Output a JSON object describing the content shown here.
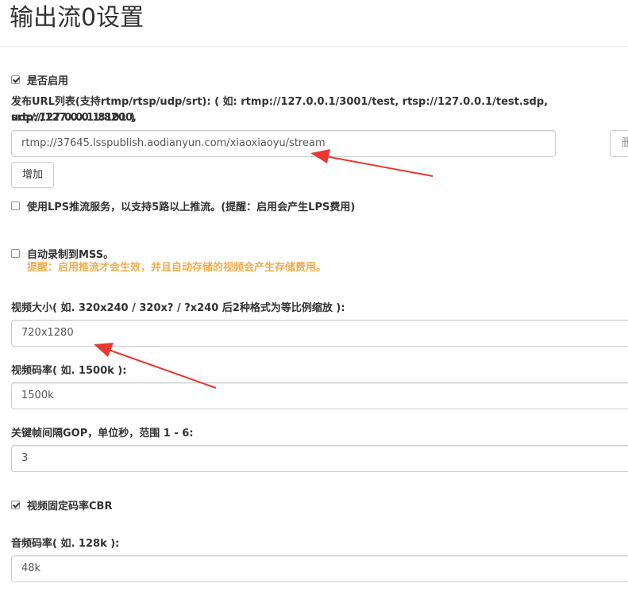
{
  "page": {
    "title": "输出流0设置"
  },
  "enable": {
    "label": "是否启用",
    "checked": true
  },
  "url_list": {
    "label_line1": "发布URL列表(支持rtmp/rtsp/udp/srt): ( 如: rtmp://127.0.0.1/3001/test, rtsp://127.0.0.1/test.sdp, udp://127.0.0.1:8200,",
    "label_line2": "srt://127.0.0.1:8101 )",
    "value": "rtmp://37645.lsspublish.aodianyun.com/xiaoxiaoyu/stream",
    "delete_label": "删",
    "add_label": "增加"
  },
  "lps": {
    "label": "使用LPS推流服务，以支持5路以上推流。(提醒：启用会产生LPS费用)",
    "checked": false
  },
  "mss": {
    "label": "自动录制到MSS。",
    "hint": "提醒：启用推流才会生效，并且自动存储的视频会产生存储费用。",
    "checked": false
  },
  "video_size": {
    "label": "视频大小( 如. 320x240 / 320x? / ?x240 后2种格式为等比例缩放 ):",
    "value": "720x1280"
  },
  "video_bitrate": {
    "label": "视频码率( 如. 1500k ):",
    "value": "1500k"
  },
  "gop": {
    "label": "关键帧间隔GOP，单位秒，范围 1 - 6:",
    "value": "3"
  },
  "cbr": {
    "label": "视频固定码率CBR",
    "checked": true
  },
  "audio_bitrate": {
    "label": "音频码率( 如. 128k ):",
    "value": "48k"
  },
  "colors": {
    "arrow": "#e8382f",
    "hint": "#f0ad4e",
    "border": "#cccccc"
  }
}
